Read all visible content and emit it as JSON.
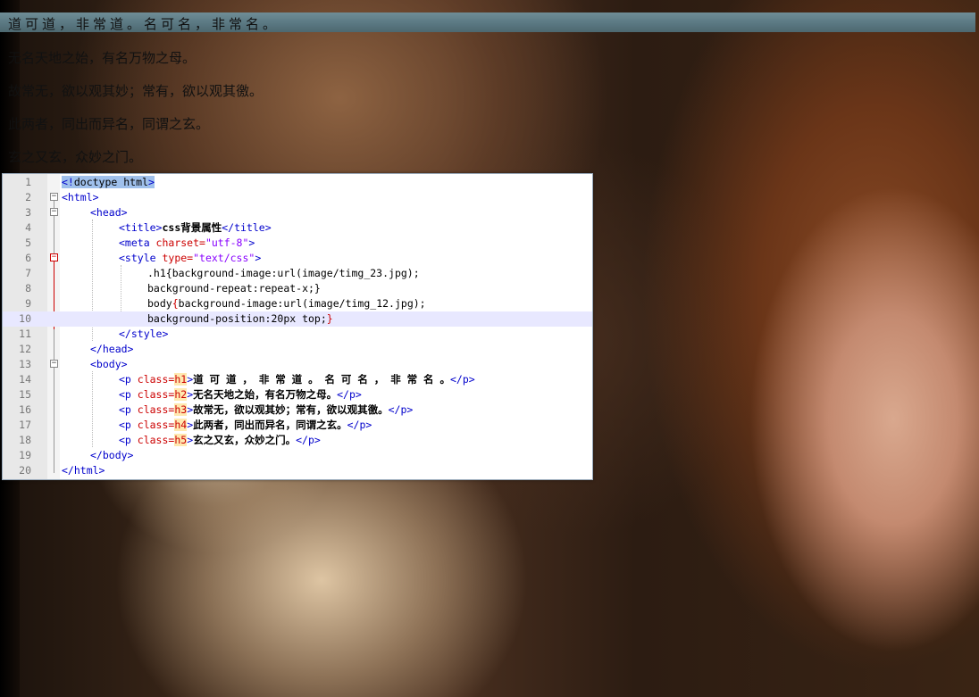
{
  "page": {
    "p1": "道可道，非常道。名可名，非常名。",
    "p2": "无名天地之始，有名万物之母。",
    "p3": "故常无，欲以观其妙；常有，欲以观其徼。",
    "p4": "此两者，同出而异名，同谓之玄。",
    "p5": "玄之又玄，众妙之门。"
  },
  "editor": {
    "line_numbers": [
      "1",
      "2",
      "3",
      "4",
      "5",
      "6",
      "7",
      "8",
      "9",
      "10",
      "11",
      "12",
      "13",
      "14",
      "15",
      "16",
      "17",
      "18",
      "19",
      "20"
    ],
    "l1_a": "<!",
    "l1_b": "doctype html",
    "l1_c": ">",
    "l2": "<html>",
    "l3": "<head>",
    "l4_open": "<title>",
    "l4_text": "css背景属性",
    "l4_close": "</title>",
    "l5_tag": "<meta ",
    "l5_attr": "charset=",
    "l5_val": "\"utf-8\"",
    "l5_end": ">",
    "l6_tag": "<style ",
    "l6_attr": "type=",
    "l6_val": "\"text/css\"",
    "l6_end": ">",
    "l7": ".h1{background-image:url(image/timg_23.jpg);",
    "l8": "background-repeat:repeat-x;}",
    "l9_a": "body",
    "l9_b": "{",
    "l9_c": "background-image:url(image/timg_12.jpg);",
    "l10_a": "background-position:20px top;",
    "l10_b": "}",
    "l11": "</style>",
    "l12": "</head>",
    "l13": "<body>",
    "p_open": "<p ",
    "p_attr": "class=",
    "p_close": "</p>",
    "gt": ">",
    "rows": [
      {
        "cls": "h1",
        "text": "道 可 道 ， 非 常 道 。 名 可 名 ， 非 常 名 。"
      },
      {
        "cls": "h2",
        "text": "无名天地之始，有名万物之母。"
      },
      {
        "cls": "h3",
        "text": "故常无，欲以观其妙；常有，欲以观其徼。"
      },
      {
        "cls": "h4",
        "text": "此两者，同出而异名，同谓之玄。"
      },
      {
        "cls": "h5",
        "text": "玄之又玄，众妙之门。"
      }
    ],
    "l19": "</body>",
    "l20": "</html>"
  }
}
